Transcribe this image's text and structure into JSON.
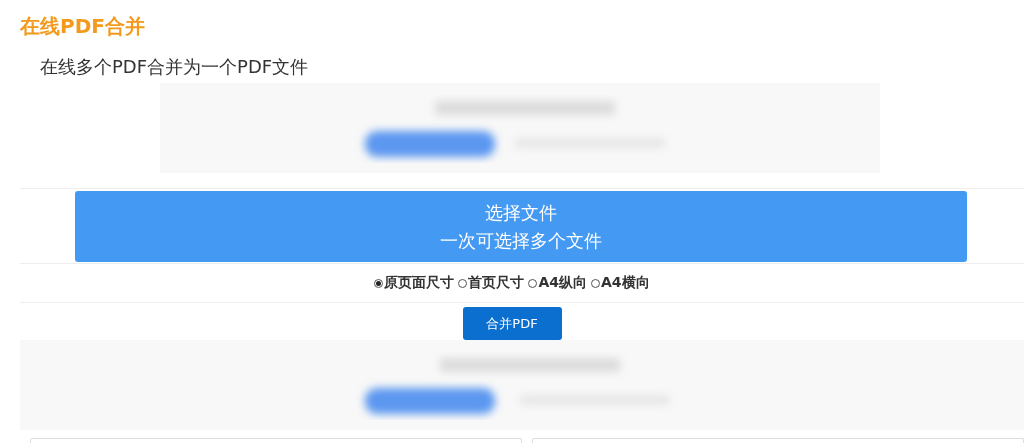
{
  "page_title": "在线PDF合并",
  "subtitle": "在线多个PDF合并为一个PDF文件",
  "upload_button": {
    "label": "选择文件",
    "hint": "一次可选择多个文件"
  },
  "size_options": [
    {
      "label": "原页面尺寸",
      "selected": true
    },
    {
      "label": "首页尺寸",
      "selected": false
    },
    {
      "label": "A4纵向",
      "selected": false
    },
    {
      "label": "A4横向",
      "selected": false
    }
  ],
  "merge_button": "合并PDF"
}
